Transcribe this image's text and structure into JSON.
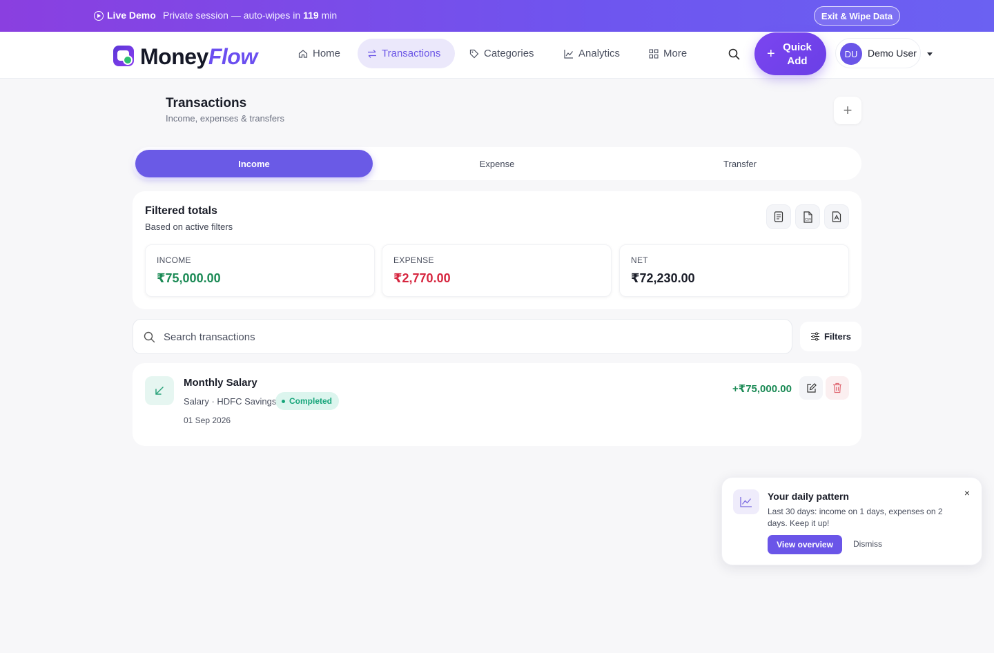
{
  "banner": {
    "live_label": "Live Demo",
    "session_text": "Private session — auto-wipes in ",
    "minutes": "119",
    "minutes_suffix": " min",
    "exit_label": "Exit & Wipe Data",
    "play_icon": "play-circle-icon"
  },
  "brand": {
    "name_part1": "Money",
    "name_part2": "Flow",
    "accent": "#6b4ff0"
  },
  "nav": {
    "items": [
      {
        "label": "Home",
        "icon": "home-icon"
      },
      {
        "label": "Transactions",
        "icon": "transfer-arrows-icon",
        "active": true
      },
      {
        "label": "Categories",
        "icon": "tag-icon"
      },
      {
        "label": "Analytics",
        "icon": "line-chart-icon"
      },
      {
        "label": "More",
        "icon": "grid-icon"
      }
    ],
    "quick_add_label": "Quick Add",
    "user_initials": "DU",
    "user_name": "Demo User"
  },
  "page": {
    "title": "Transactions",
    "subtitle": "Income, expenses & transfers"
  },
  "tabs": [
    {
      "label": "Income",
      "active": true
    },
    {
      "label": "Expense"
    },
    {
      "label": "Transfer"
    }
  ],
  "totals": {
    "title": "Filtered totals",
    "subtitle": "Based on active filters",
    "export_icons": [
      "document-icon",
      "csv-file-icon",
      "pdf-file-icon"
    ],
    "stats": [
      {
        "label": "INCOME",
        "value": "₹75,000.00",
        "color": "#1b8a55"
      },
      {
        "label": "EXPENSE",
        "value": "₹2,770.00",
        "color": "#d6263f"
      },
      {
        "label": "NET",
        "value": "₹72,230.00",
        "color": "#1a1d28"
      }
    ]
  },
  "search": {
    "placeholder": "Search transactions",
    "filters_label": "Filters"
  },
  "transactions": [
    {
      "title": "Monthly Salary",
      "meta": "Salary · HDFC Savings",
      "status": "Completed",
      "date": "01 Sep 2026",
      "amount": "+₹75,000.00",
      "icon": "arrow-down-left-icon"
    }
  ],
  "toast": {
    "title": "Your daily pattern",
    "body": "Last 30 days: income on 1 days, expenses on 2 days. Keep it up!",
    "primary_label": "View overview",
    "dismiss_label": "Dismiss",
    "icon": "trend-chart-icon"
  }
}
